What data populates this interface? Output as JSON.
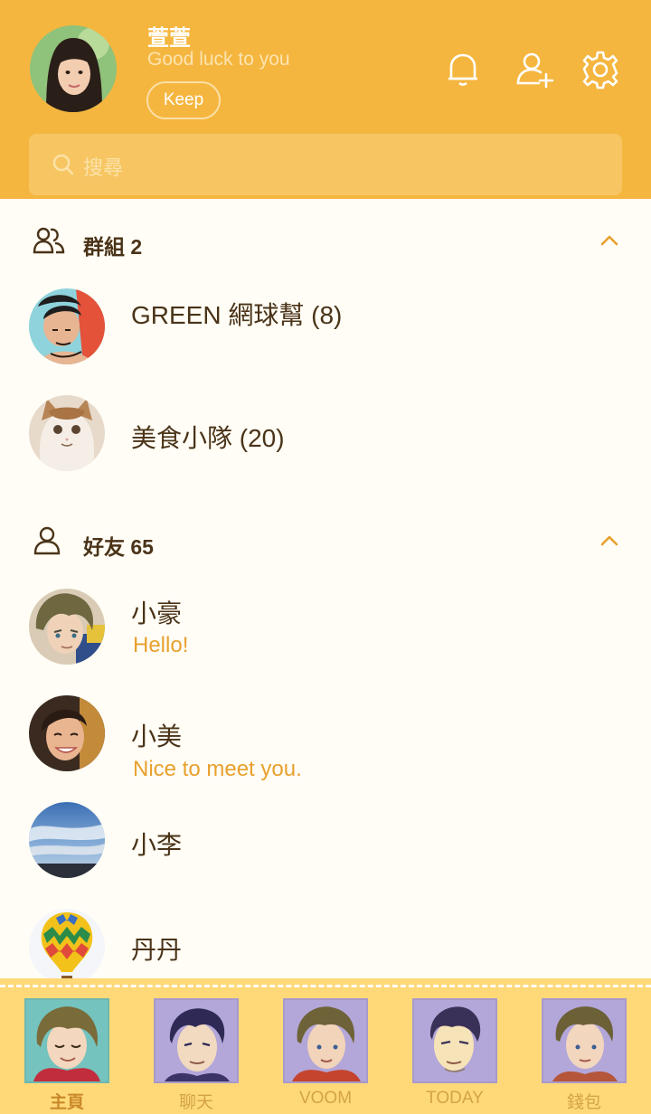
{
  "profile": {
    "name": "萱萱",
    "status": "Good luck to you",
    "keep_label": "Keep"
  },
  "header_icons": [
    "bell-icon",
    "add-friend-icon",
    "gear-icon"
  ],
  "search": {
    "placeholder": "搜尋"
  },
  "groups_section": {
    "title": "群組 2",
    "items": [
      {
        "name": "GREEN 網球幫 (8)"
      },
      {
        "name": "美食小隊 (20)"
      }
    ]
  },
  "friends_section": {
    "title": "好友 65",
    "items": [
      {
        "name": "小豪",
        "status": "Hello!"
      },
      {
        "name": "小美",
        "status": "Nice to meet you."
      },
      {
        "name": "小李",
        "status": ""
      },
      {
        "name": "丹丹",
        "status": ""
      }
    ]
  },
  "tabs": [
    {
      "label": "主頁",
      "active": true
    },
    {
      "label": "聊天",
      "active": false
    },
    {
      "label": "VOOM",
      "active": false
    },
    {
      "label": "TODAY",
      "active": false
    },
    {
      "label": "錢包",
      "active": false
    }
  ],
  "colors": {
    "header": "#F5B63F",
    "background": "#FFFDF5",
    "accent_text": "#E8A02E",
    "primary_text": "#4A3318",
    "tabbar": "#FFD978"
  }
}
